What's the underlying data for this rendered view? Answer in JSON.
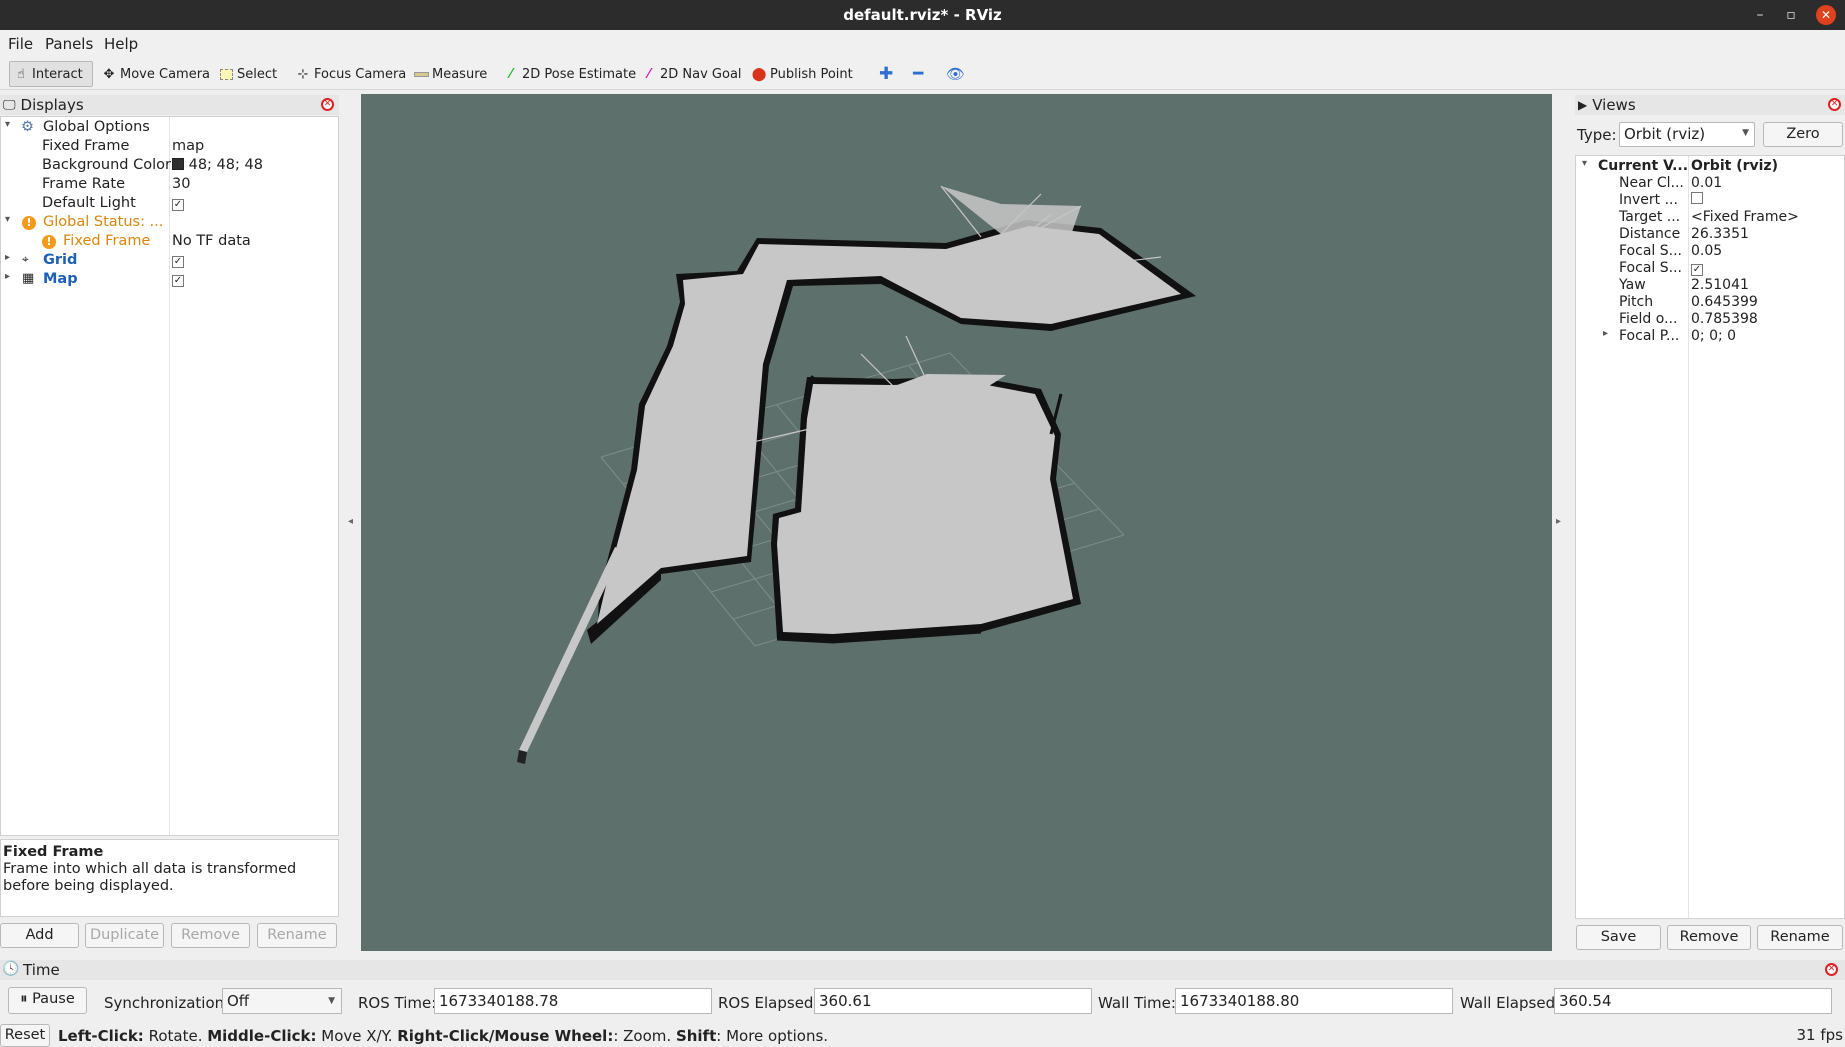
{
  "window": {
    "title": "default.rviz* - RViz",
    "minimize": "–",
    "maximize": "▫",
    "close": "✕"
  },
  "menu": {
    "file": "File",
    "panels": "Panels",
    "help": "Help"
  },
  "toolbar": {
    "interact": "Interact",
    "move_camera": "Move Camera",
    "select": "Select",
    "focus_camera": "Focus Camera",
    "measure": "Measure",
    "pose_estimate": "2D Pose Estimate",
    "nav_goal": "2D Nav Goal",
    "publish_point": "Publish Point"
  },
  "displays": {
    "title": "Displays",
    "global_options": "Global Options",
    "fixed_frame_label": "Fixed Frame",
    "fixed_frame_value": "map",
    "bg_color_label": "Background Color",
    "bg_color_value": "48; 48; 48",
    "bg_color_swatch": "#303030",
    "frame_rate_label": "Frame Rate",
    "frame_rate_value": "30",
    "default_light_label": "Default Light",
    "global_status": "Global Status: ...",
    "status_fixed_frame": "Fixed Frame",
    "status_fixed_frame_value": "No TF data",
    "grid": "Grid",
    "map": "Map",
    "checked": "✓"
  },
  "help": {
    "title": "Fixed Frame",
    "text": "Frame into which all data is transformed before being displayed."
  },
  "display_buttons": {
    "add": "Add",
    "duplicate": "Duplicate",
    "remove": "Remove",
    "rename": "Rename"
  },
  "views": {
    "title": "Views",
    "type_label": "Type:",
    "type_value": "Orbit (rviz)",
    "zero": "Zero",
    "current_label": "Current V...",
    "current_value": "Orbit (rviz)",
    "rows": [
      {
        "label": "Near Cl...",
        "value": "0.01"
      },
      {
        "label": "Invert ...",
        "value": ""
      },
      {
        "label": "Target ...",
        "value": "<Fixed Frame>"
      },
      {
        "label": "Distance",
        "value": "26.3351"
      },
      {
        "label": "Focal S...",
        "value": "0.05"
      },
      {
        "label": "Focal S...",
        "value": "✓"
      },
      {
        "label": "Yaw",
        "value": "2.51041"
      },
      {
        "label": "Pitch",
        "value": "0.645399"
      },
      {
        "label": "Field o...",
        "value": "0.785398"
      },
      {
        "label": "Focal P...",
        "value": "0; 0; 0"
      }
    ],
    "save": "Save",
    "remove": "Remove",
    "rename": "Rename"
  },
  "time": {
    "title": "Time",
    "pause": "Pause",
    "sync_label": "Synchronization:",
    "sync_value": "Off",
    "ros_time_label": "ROS Time:",
    "ros_time": "1673340188.78",
    "ros_elapsed_label": "ROS Elapsed:",
    "ros_elapsed": "360.61",
    "wall_time_label": "Wall Time:",
    "wall_time": "1673340188.80",
    "wall_elapsed_label": "Wall Elapsed:",
    "wall_elapsed": "360.54"
  },
  "status": {
    "reset": "Reset",
    "k1": "Left-Click:",
    "t1": " Rotate. ",
    "k2": "Middle-Click:",
    "t2": " Move X/Y. ",
    "k3": "Right-Click/Mouse Wheel:",
    "t3": ": Zoom. ",
    "k4": "Shift",
    "t4": ": More options.",
    "fps": "31 fps"
  },
  "colors": {
    "viewport_bg": "#5e706c",
    "map_free": "#c7c7c7",
    "map_wall": "#111111"
  }
}
